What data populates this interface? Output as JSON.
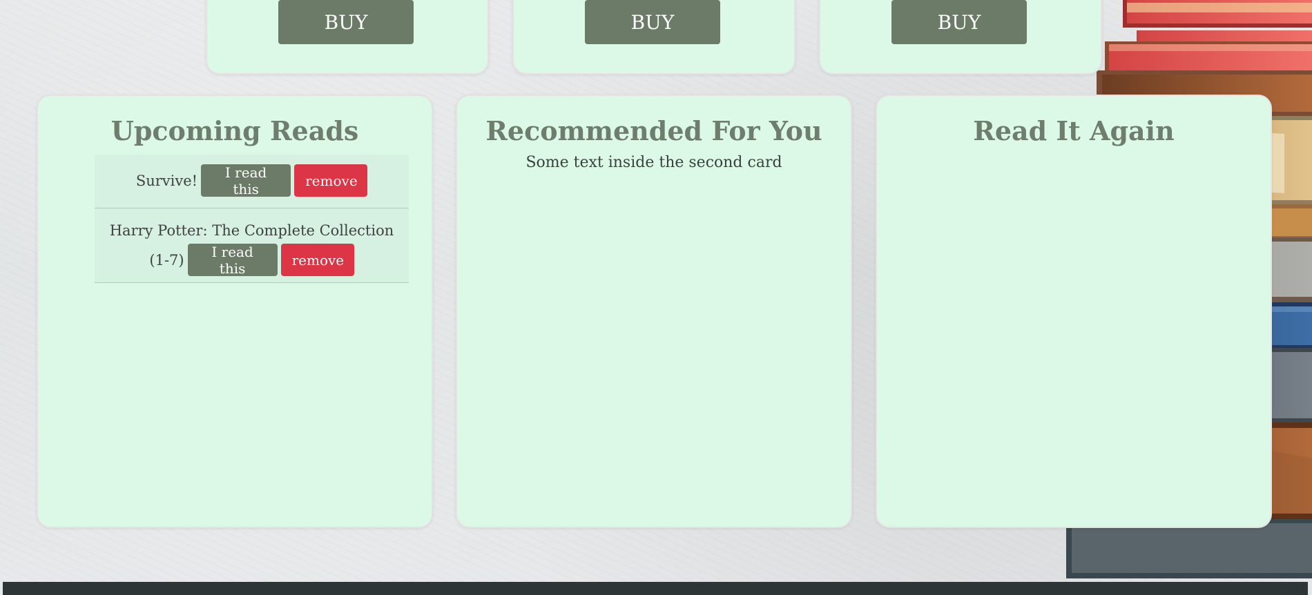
{
  "top_cards": [
    {
      "buy_label": "BUY"
    },
    {
      "buy_label": "BUY"
    },
    {
      "buy_label": "BUY"
    }
  ],
  "main": {
    "upcoming_reads": {
      "title": "Upcoming Reads",
      "items": [
        {
          "title": "Survive!",
          "read_button": "I read this",
          "remove_button": "remove"
        },
        {
          "title_line_1": "Harry Potter: The Complete Collection",
          "title_line_2": "(1-7)",
          "read_button": "I read this",
          "remove_button": "remove"
        }
      ]
    },
    "recommended": {
      "title": "Recommended For You",
      "text": "Some text inside the second card"
    },
    "read_it_again": {
      "title": "Read It Again"
    }
  }
}
